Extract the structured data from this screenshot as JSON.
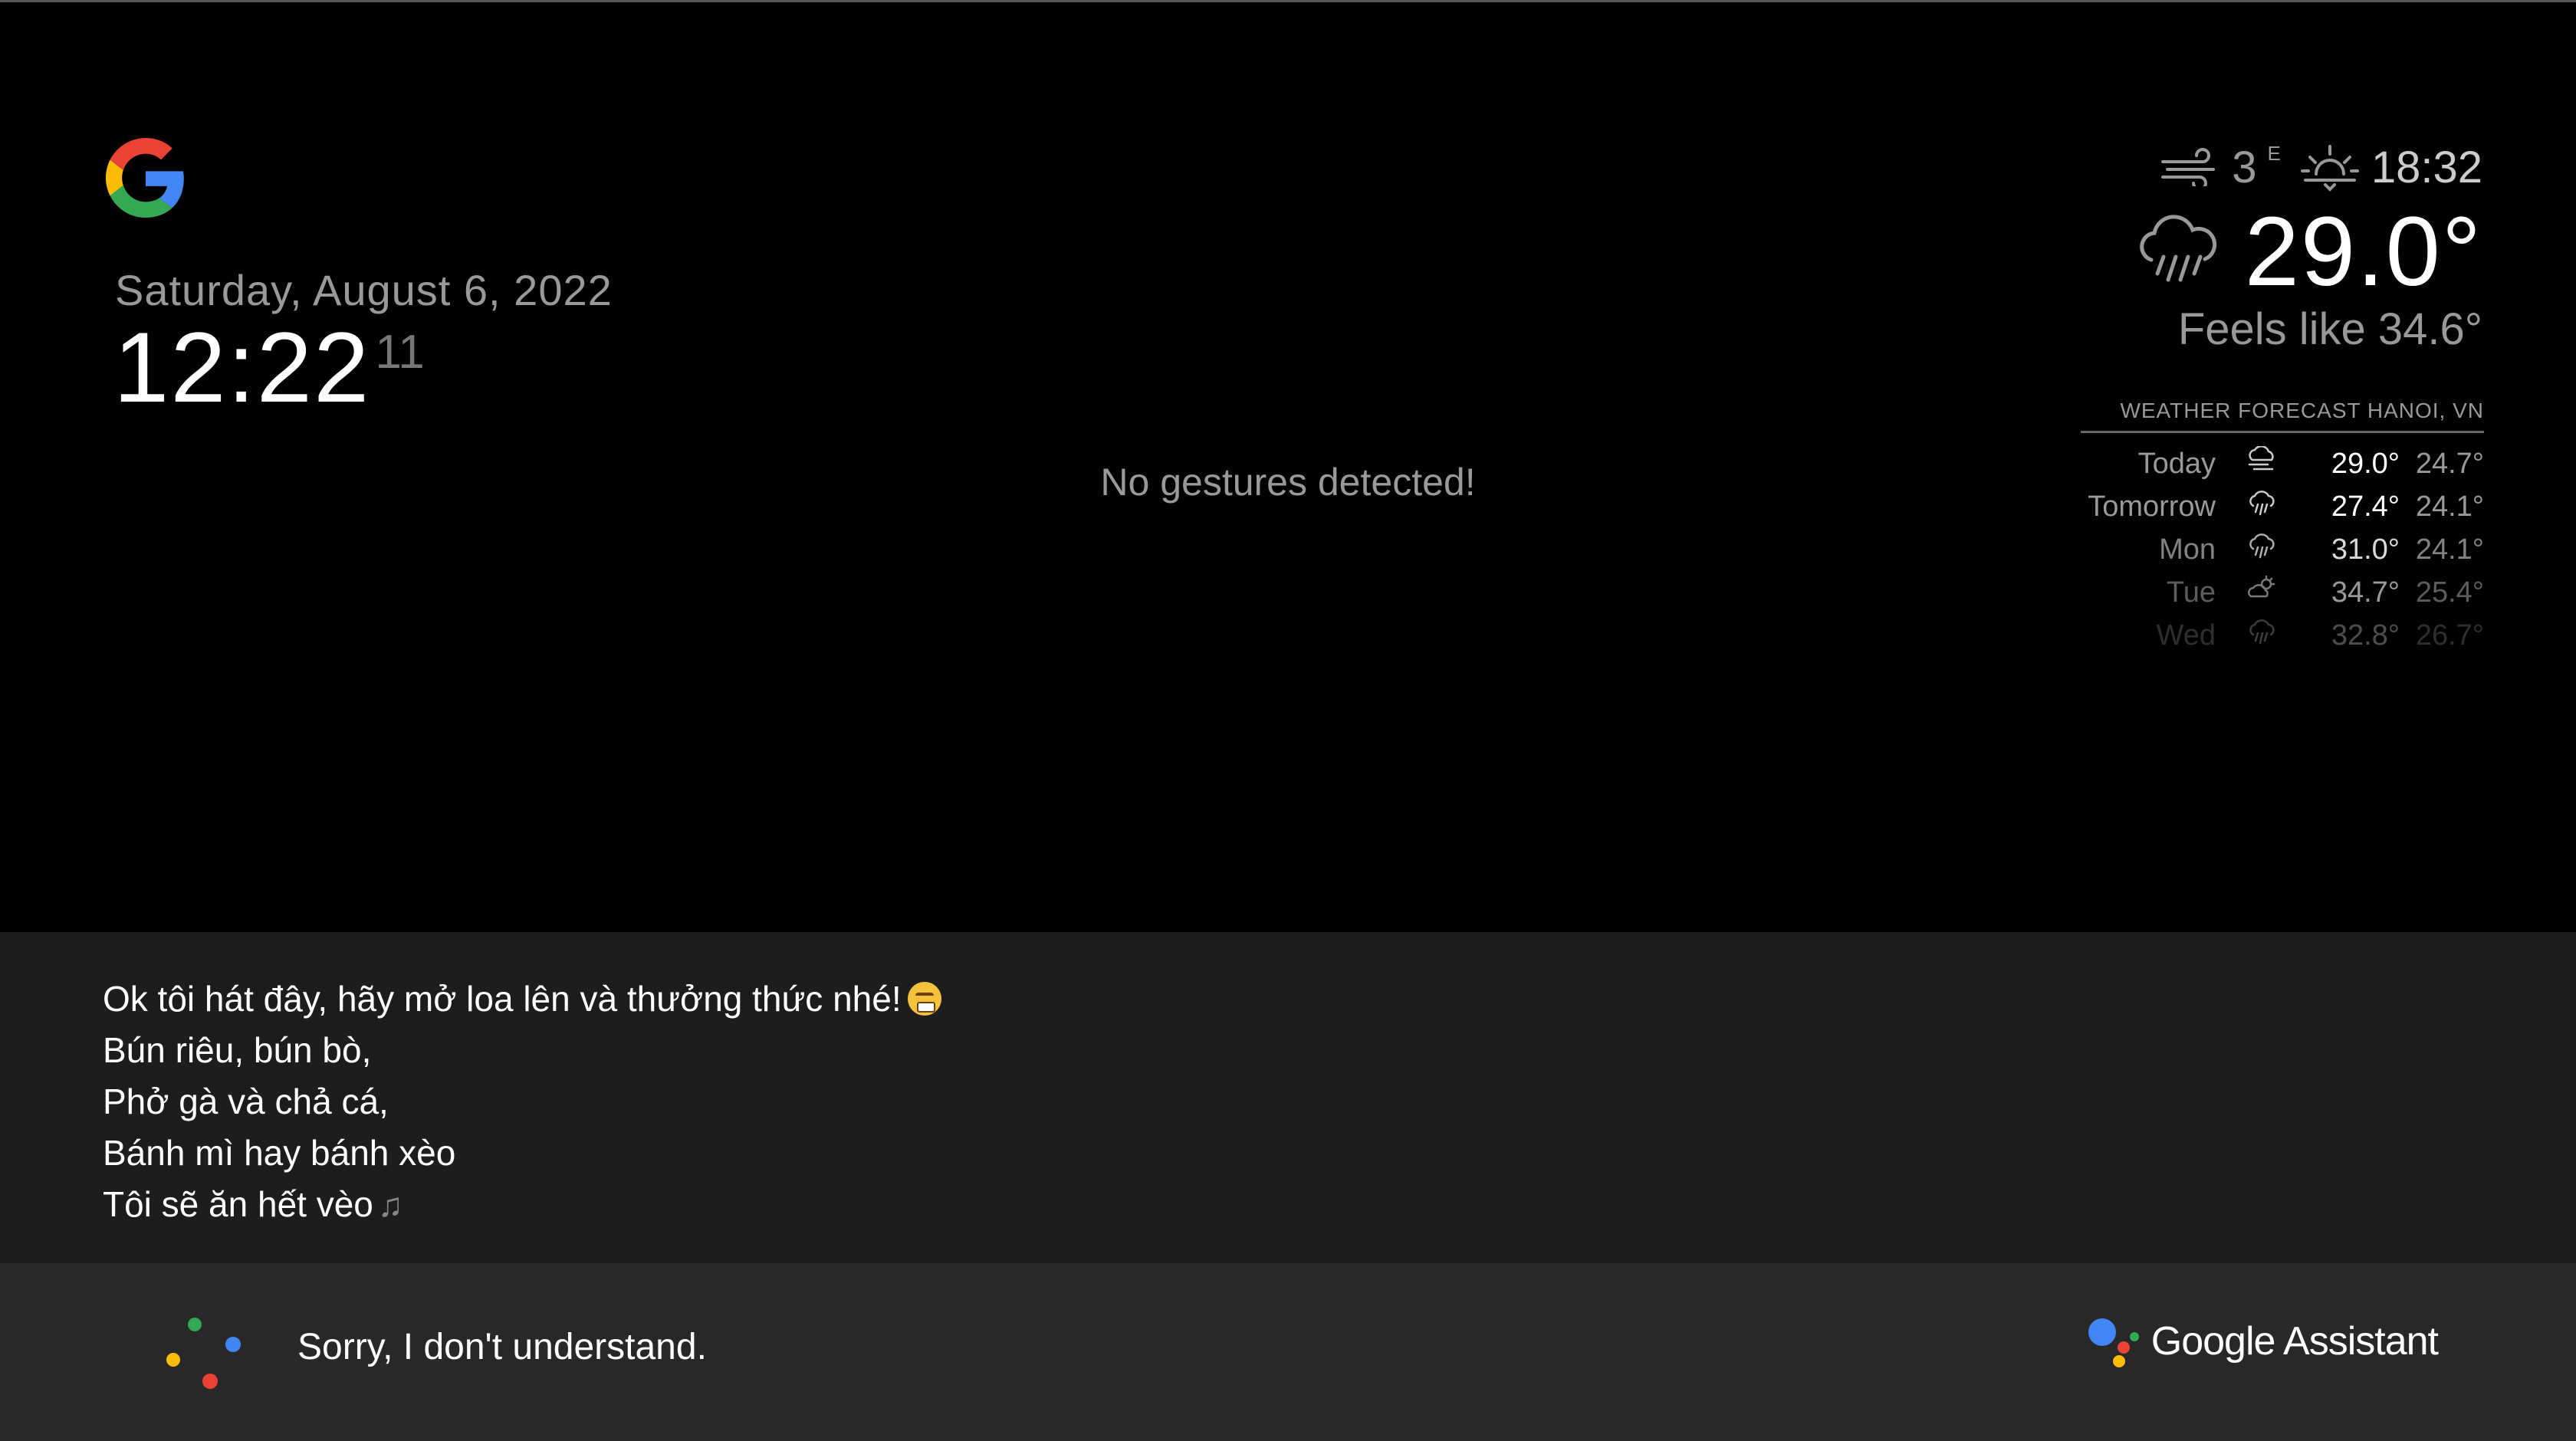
{
  "clock": {
    "date": "Saturday, August 6, 2022",
    "time": "12:22",
    "seconds": "11"
  },
  "gestures": {
    "status": "No gestures detected!"
  },
  "current_weather": {
    "wind_speed": "3",
    "wind_direction": "E",
    "sunset_time": "18:32",
    "temperature": "29.0°",
    "feels_like": "Feels like 34.6°",
    "icons": [
      "wind-icon",
      "sunset-icon",
      "rain-cloud-icon"
    ]
  },
  "forecast": {
    "header": "WEATHER FORECAST HANOI, VN",
    "days": [
      {
        "day": "Today",
        "icon": "cloud-wind-icon",
        "max": "29.0°",
        "min": "24.7°",
        "opacity": 1.0
      },
      {
        "day": "Tomorrow",
        "icon": "rain-icon",
        "max": "27.4°",
        "min": "24.1°",
        "opacity": 1.0
      },
      {
        "day": "Mon",
        "icon": "rain-icon",
        "max": "31.0°",
        "min": "24.1°",
        "opacity": 0.85
      },
      {
        "day": "Tue",
        "icon": "partly-sunny-icon",
        "max": "34.7°",
        "min": "25.4°",
        "opacity": 0.6
      },
      {
        "day": "Wed",
        "icon": "rain-icon",
        "max": "32.8°",
        "min": "26.7°",
        "opacity": 0.3
      }
    ]
  },
  "transcript": {
    "lines": [
      "Ok tôi hát đây, hãy mở loa lên và thưởng thức nhé!",
      "Bún riêu, bún bò,",
      "Phở gà và chả cá,",
      "Bánh mì hay bánh xèo",
      "Tôi sẽ ăn hết vèo"
    ]
  },
  "assistant": {
    "response": "Sorry, I don't understand.",
    "brand": "Google Assistant"
  },
  "colors": {
    "background": "#000000",
    "panel": "#1d1d1d",
    "bar": "#282828",
    "dim_text": "#999999",
    "google_blue": "#4285F4",
    "google_red": "#EA4335",
    "google_yellow": "#FBBC05",
    "google_green": "#34A853"
  }
}
